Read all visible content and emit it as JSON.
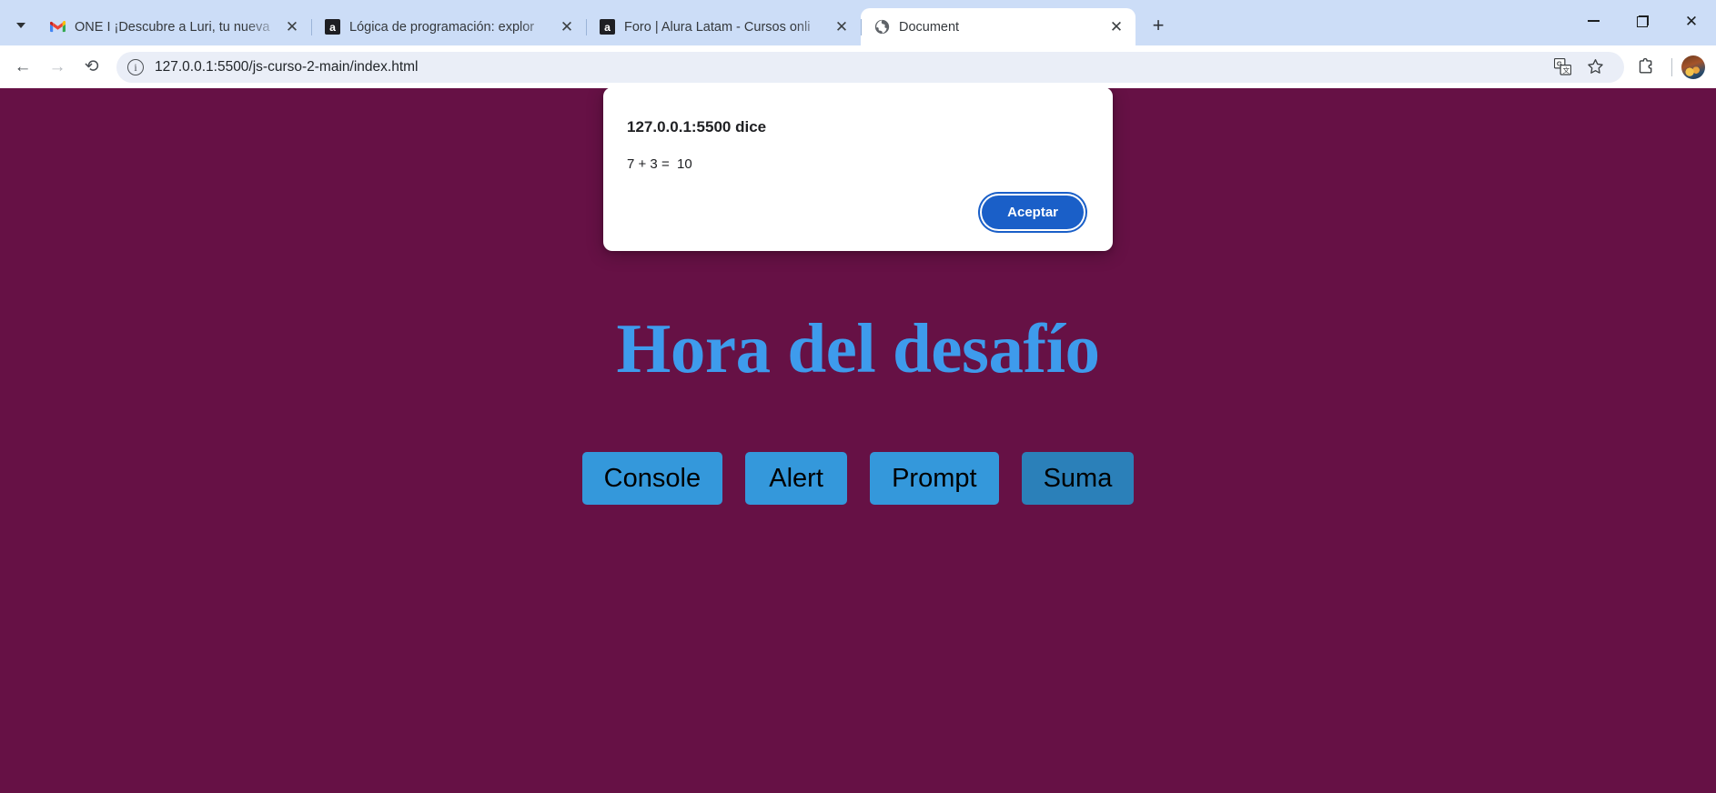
{
  "browser": {
    "tabstrip": {
      "tab_search_icon": "chevron-down-icon",
      "new_tab_label": "+",
      "tabs": [
        {
          "favicon": "gmail-icon",
          "title": "ONE I ¡Descubre a Luri, tu nueva",
          "close_label": "✕",
          "active": false
        },
        {
          "favicon": "alura-icon",
          "title": "Lógica de programación: explor",
          "close_label": "✕",
          "active": false
        },
        {
          "favicon": "alura-icon",
          "title": "Foro | Alura Latam - Cursos onli",
          "close_label": "✕",
          "active": false
        },
        {
          "favicon": "globe-icon",
          "title": "Document",
          "close_label": "✕",
          "active": true
        }
      ]
    },
    "window_controls": {
      "minimize": "minimize-icon",
      "restore": "restore-icon",
      "close": "✕"
    },
    "toolbar": {
      "back_label": "←",
      "forward_label": "→",
      "reload_label": "⟳",
      "site_info_label": "i",
      "url": "127.0.0.1:5500/js-curso-2-main/index.html",
      "translate_label": "translate-icon",
      "bookmark_label": "☆",
      "extensions_label": "extensions-puzzle-icon",
      "profile_label": "avatar"
    }
  },
  "page": {
    "background_color": "#661145",
    "heading": "Hora del desafío",
    "heading_color": "#3e9bec",
    "buttons": [
      {
        "label": "Console",
        "state": "normal",
        "color": "#3498db"
      },
      {
        "label": "Alert",
        "state": "normal",
        "color": "#3498db"
      },
      {
        "label": "Prompt",
        "state": "normal",
        "color": "#3498db"
      },
      {
        "label": "Suma",
        "state": "pressed",
        "color": "#2b80b9"
      }
    ]
  },
  "dialog": {
    "title": "127.0.0.1:5500 dice",
    "message": "7 + 3 =  10",
    "ok_label": "Aceptar",
    "ok_color": "#1a5fc8"
  }
}
